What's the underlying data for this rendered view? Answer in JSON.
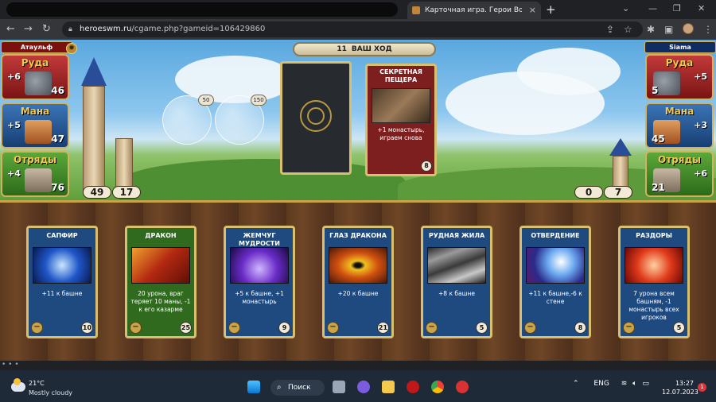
{
  "browser": {
    "tab_title": "Карточная игра. Герои Войны и Денег",
    "url_host": "heroeswm.ru",
    "url_path": "/cgame.php?gameid=106429860",
    "close_tab": "×",
    "new_tab": "+",
    "win_min": "—",
    "win_max": "❐",
    "win_close": "✕"
  },
  "game": {
    "turn_number": "11",
    "turn_label": "ВАШ ХОД",
    "player1": {
      "name": "Атаульф",
      "resources": [
        {
          "label": "Руда",
          "income": "+6",
          "amount": "46",
          "color": "#b62f2f"
        },
        {
          "label": "Мана",
          "income": "+5",
          "amount": "47",
          "color": "#2d64a8"
        },
        {
          "label": "Отряды",
          "income": "+4",
          "amount": "76",
          "color": "#4c9530"
        }
      ],
      "tower": "49",
      "wall": "17"
    },
    "player2": {
      "name": "Siama",
      "resources": [
        {
          "label": "Руда",
          "income": "+5",
          "amount": "5",
          "color": "#b62f2f"
        },
        {
          "label": "Мана",
          "income": "+3",
          "amount": "45",
          "color": "#2d64a8"
        },
        {
          "label": "Отряды",
          "income": "+6",
          "amount": "21",
          "color": "#4c9530"
        }
      ],
      "tower": "0",
      "wall": "7"
    },
    "bubbles": [
      {
        "name": "tower-upgrade",
        "cost": "50"
      },
      {
        "name": "knight-upgrade",
        "cost": "150"
      }
    ],
    "played_card": {
      "title": "СЕКРЕТНАЯ ПЕЩЕРА",
      "desc": "+1 монастырь, играем снова",
      "cost": "8"
    },
    "hand": [
      {
        "title": "САПФИР",
        "desc": "+11 к башне",
        "cost": "10",
        "type": "blue"
      },
      {
        "title": "ДРАКОН",
        "desc": "20 урона, враг теряет 10 маны, -1 к его казарме",
        "cost": "25",
        "type": "green"
      },
      {
        "title": "ЖЕМЧУГ МУДРОСТИ",
        "desc": "+5 к башне, +1 монастырь",
        "cost": "9",
        "type": "blue"
      },
      {
        "title": "ГЛАЗ ДРАКОНА",
        "desc": "+20 к башне",
        "cost": "21",
        "type": "blue"
      },
      {
        "title": "РУДНАЯ ЖИЛА",
        "desc": "+8 к башне",
        "cost": "5",
        "type": "blue"
      },
      {
        "title": "ОТВЕРДЕНИЕ",
        "desc": "+11 к башне,-6 к стене",
        "cost": "8",
        "type": "blue"
      },
      {
        "title": "РАЗДОРЫ",
        "desc": "7 урона всем башням, -1 монастырь всех игроков",
        "cost": "5",
        "type": "blue"
      }
    ]
  },
  "status_dots": "• • •",
  "taskbar": {
    "temp": "21°C",
    "condition": "Mostly cloudy",
    "search_label": "Поиск",
    "lang": "ENG",
    "time": "13:27",
    "date": "12.07.2023",
    "notifications": "1"
  }
}
